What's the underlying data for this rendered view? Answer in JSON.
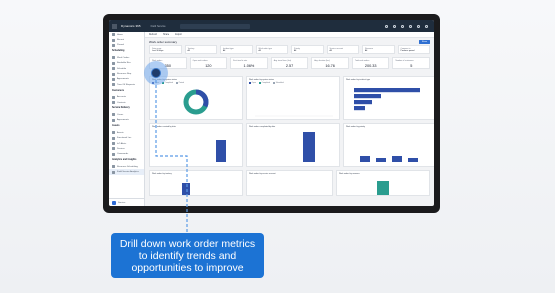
{
  "app": {
    "name": "Dynamics 365",
    "breadcrumb": "Field Service"
  },
  "sidebar": {
    "items_top": [
      {
        "label": "Home",
        "icon": "home-icon"
      },
      {
        "label": "Recent",
        "icon": "clock-icon"
      },
      {
        "label": "Pinned",
        "icon": "pin-icon"
      }
    ],
    "group1": "Scheduling",
    "items_sched": [
      {
        "label": "Work Orders",
        "icon": "clipboard-icon"
      },
      {
        "label": "Bookable Res.",
        "icon": "person-icon"
      },
      {
        "label": "Schedule",
        "icon": "calendar-icon"
      },
      {
        "label": "Resource Req.",
        "icon": "list-icon"
      },
      {
        "label": "Agreements",
        "icon": "doc-icon"
      },
      {
        "label": "Time Off Requests",
        "icon": "clock-icon"
      }
    ],
    "group2": "Customers",
    "items_cust": [
      {
        "label": "Accounts",
        "icon": "building-icon"
      },
      {
        "label": "Contacts",
        "icon": "person-icon"
      }
    ],
    "group3": "Service Delivery",
    "items_svc": [
      {
        "label": "Cases",
        "icon": "case-icon"
      },
      {
        "label": "Agreements",
        "icon": "doc-icon"
      }
    ],
    "group4": "Assets",
    "items_assets": [
      {
        "label": "Assets",
        "icon": "cube-icon"
      },
      {
        "label": "Functional Loc.",
        "icon": "pin-icon"
      },
      {
        "label": "IoT Alerts",
        "icon": "bell-icon"
      },
      {
        "label": "Devices",
        "icon": "chip-icon"
      },
      {
        "label": "Commands",
        "icon": "terminal-icon"
      }
    ],
    "group5": "Analytics and Insights",
    "items_analytics": [
      {
        "label": "Resource Scheduling",
        "icon": "chart-icon"
      },
      {
        "label": "Field Service Analytics",
        "icon": "chart-icon",
        "active": true
      }
    ],
    "footer": "Service"
  },
  "main": {
    "commands": [
      "Refresh",
      "Share",
      "Export"
    ],
    "title": "Work order summary",
    "share_label": "Share",
    "filters": [
      {
        "label": "Date range",
        "value": "Last 30 days"
      },
      {
        "label": "Territory",
        "value": "All"
      },
      {
        "label": "Incident type",
        "value": "All"
      },
      {
        "label": "Work order type",
        "value": "All"
      },
      {
        "label": "Priority",
        "value": "All"
      },
      {
        "label": "Service account",
        "value": "All"
      },
      {
        "label": "Resource",
        "value": "All"
      },
      {
        "label": "Compare to",
        "value": "Previous period"
      }
    ],
    "kpis": [
      {
        "label": "Work orders",
        "value": "350"
      },
      {
        "label": "Open work orders",
        "value": "120"
      },
      {
        "label": "First time fix rate",
        "value": "1.06%"
      },
      {
        "label": "Avg. travel time (hrs)",
        "value": "2.57"
      },
      {
        "label": "Avg. duration (hrs)",
        "value": "16.76"
      },
      {
        "label": "Total work orders",
        "value": "200.33"
      },
      {
        "label": "Number of customers",
        "value": "5"
      }
    ],
    "cards": {
      "c1": {
        "title": "Work orders by system status",
        "legend": [
          "Open",
          "Completed",
          "Posted",
          "Scheduled"
        ]
      },
      "c2": {
        "title": "Work orders by system status",
        "legend": [
          "Open",
          "Completed",
          "Posted",
          "Scheduled"
        ]
      },
      "c3": {
        "title": "Work orders by incident type"
      },
      "c4": {
        "title": "Work orders created by date"
      },
      "c5": {
        "title": "Work orders completed by date"
      },
      "c6": {
        "title": "Work orders by priority"
      },
      "c7": {
        "title": "Work orders by territory"
      },
      "c8": {
        "title": "Work orders by service account"
      },
      "c9": {
        "title": "Work orders by resource"
      }
    }
  },
  "callout": {
    "text": "Drill down work order metrics to identify trends and opportunities to improve"
  },
  "colors": {
    "accent": "#1c73d4",
    "bar": "#2f4fa8",
    "teal": "#2a9d8f",
    "topbar": "#1f2d3d"
  }
}
